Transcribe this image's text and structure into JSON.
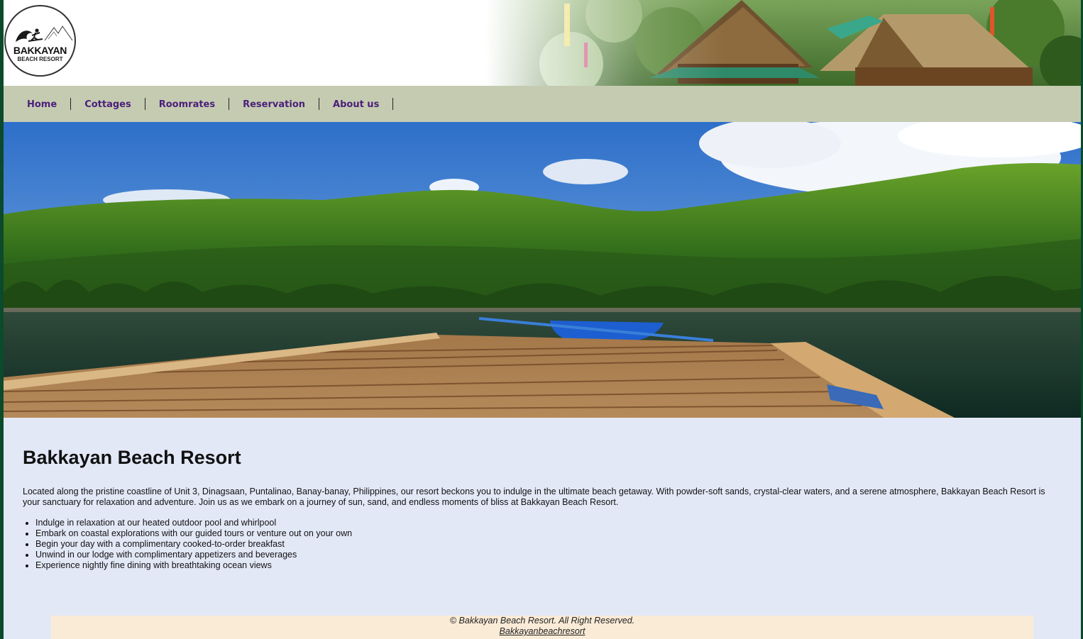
{
  "logo": {
    "name": "BAKKAYAN",
    "subtitle": "BEACH RESORT"
  },
  "nav": {
    "items": [
      {
        "label": "Home"
      },
      {
        "label": "Cottages"
      },
      {
        "label": "Roomrates"
      },
      {
        "label": "Reservation"
      },
      {
        "label": "About us"
      }
    ]
  },
  "main": {
    "title": "Bakkayan Beach Resort",
    "intro": "Located along the pristine coastline of Unit 3, Dinagsaan, Puntalinao, Banay-banay, Philippines, our resort beckons you to indulge in the ultimate beach getaway. With powder-soft sands, crystal-clear waters, and a serene atmosphere, Bakkayan Beach Resort is your sanctuary for relaxation and adventure. Join us as we embark on a journey of sun, sand, and endless moments of bliss at Bakkayan Beach Resort.",
    "features": [
      "Indulge in relaxation at our heated outdoor pool and whirlpool",
      "Embark on coastal explorations with our guided tours or venture out on your own",
      "Begin your day with a complimentary cooked-to-order breakfast",
      "Unwind in our lodge with complimentary appetizers and beverages",
      "Experience nightly fine dining with breathtaking ocean views"
    ]
  },
  "footer": {
    "copyright": "© Bakkayan Beach Resort. All Right Reserved.",
    "link": "Bakkayanbeachresort"
  },
  "colors": {
    "nav_bg": "#c5cbb1",
    "nav_text": "#4a1f7a",
    "page_bg": "#e3e8f7",
    "footer_bg": "#faebd7",
    "frame": "#0b4a2a"
  }
}
